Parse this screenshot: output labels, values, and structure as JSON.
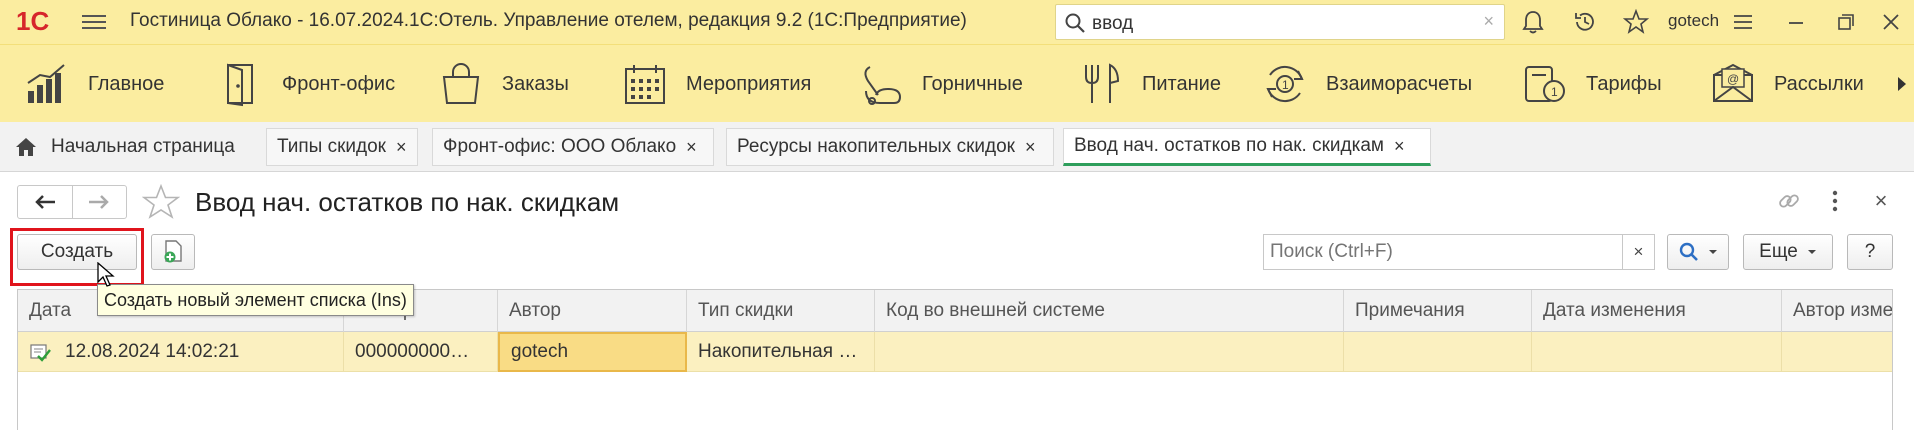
{
  "titlebar": {
    "app_title": "Гостиница Облако - 16.07.2024.1С:Отель. Управление отелем, редакция 9.2  (1С:Предприятие)",
    "search_value": "ввод",
    "search_clear": "×",
    "user": "gotech",
    "logo_text": "1С"
  },
  "sections": [
    {
      "label": "Главное",
      "icon": "bar-chart-icon"
    },
    {
      "label": "Фронт-офис",
      "icon": "door-icon"
    },
    {
      "label": "Заказы",
      "icon": "shopping-bag-icon"
    },
    {
      "label": "Мероприятия",
      "icon": "calendar-icon"
    },
    {
      "label": "Горничные",
      "icon": "vacuum-icon"
    },
    {
      "label": "Питание",
      "icon": "cutlery-icon"
    },
    {
      "label": "Взаиморасчеты",
      "icon": "settlement-icon"
    },
    {
      "label": "Тарифы",
      "icon": "tariff-icon"
    },
    {
      "label": "Рассылки",
      "icon": "mail-icon"
    }
  ],
  "tabs": [
    {
      "label": "Начальная страница"
    },
    {
      "label": "Типы скидок",
      "close": "×"
    },
    {
      "label": "Фронт-офис: ООО Облако",
      "close": "×"
    },
    {
      "label": "Ресурсы накопительных скидок",
      "close": "×"
    },
    {
      "label": "Ввод нач. остатков по нак. скидкам",
      "close": "×"
    }
  ],
  "form": {
    "title": "Ввод нач. остатков по нак. скидкам",
    "close": "×"
  },
  "toolbar": {
    "create_label": "Создать",
    "search_placeholder": "Поиск (Ctrl+F)",
    "search_clear": "×",
    "more_label": "Еще",
    "help_label": "?"
  },
  "tooltip": "Создать новый элемент списка (Ins)",
  "grid": {
    "columns": [
      "Дата",
      "Номер",
      "Автор",
      "Тип скидки",
      "Код во внешней системе",
      "Примечания",
      "Дата изменения",
      "Автор изме"
    ],
    "rows": [
      [
        "12.08.2024 14:02:21",
        "000000000…",
        "gotech",
        "Накопительная …",
        "",
        "",
        "",
        ""
      ]
    ]
  }
}
